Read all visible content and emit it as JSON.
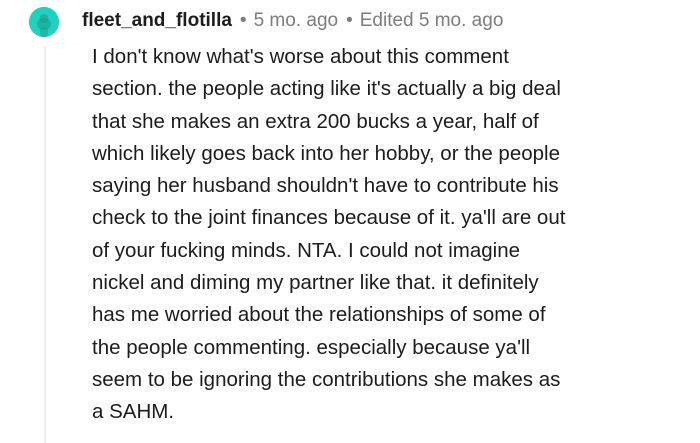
{
  "comment": {
    "username": "fleet_and_flotilla",
    "separator": "•",
    "age": "5 mo. ago",
    "edited": "Edited 5 mo. ago",
    "avatar_color": "#21d1bf",
    "body_lines": [
      "I don't know what's worse about this comment",
      "section. the people acting like it's actually a big deal",
      "that she makes an extra 200 bucks a year, half of",
      "which likely goes back into her hobby, or the people",
      "saying her husband shouldn't have to contribute his",
      "check to the joint finances because of it. ya'll are out",
      "of your fucking minds. NTA. I could not imagine",
      "nickel and diming my partner like that. it definitely",
      "has me worried about the relationships of some of",
      "the people commenting. especially because ya'll",
      "seem to be ignoring the contributions she makes as",
      "a SAHM."
    ]
  }
}
